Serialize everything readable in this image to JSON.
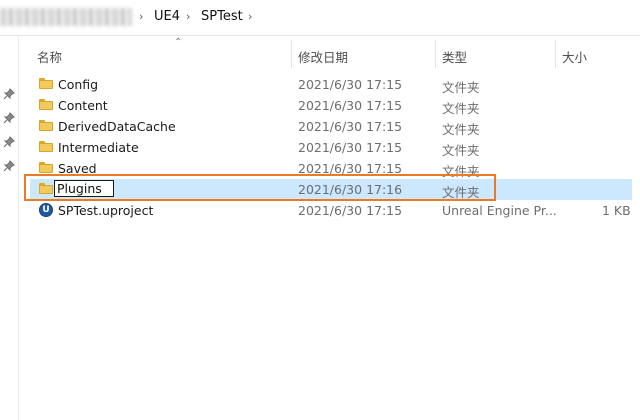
{
  "breadcrumb": {
    "segments": [
      "UE4",
      "SPTest"
    ],
    "separator": "›"
  },
  "columns": {
    "name": "名称",
    "date": "修改日期",
    "type": "类型",
    "size": "大小"
  },
  "files": [
    {
      "name": "Config",
      "date": "2021/6/30 17:15",
      "type": "文件夹",
      "size": "",
      "icon": "folder-icon"
    },
    {
      "name": "Content",
      "date": "2021/6/30 17:15",
      "type": "文件夹",
      "size": "",
      "icon": "folder-icon"
    },
    {
      "name": "DerivedDataCache",
      "date": "2021/6/30 17:15",
      "type": "文件夹",
      "size": "",
      "icon": "folder-icon"
    },
    {
      "name": "Intermediate",
      "date": "2021/6/30 17:15",
      "type": "文件夹",
      "size": "",
      "icon": "folder-icon"
    },
    {
      "name": "Saved",
      "date": "2021/6/30 17:15",
      "type": "文件夹",
      "size": "",
      "icon": "folder-icon"
    },
    {
      "name": "Plugins",
      "date": "2021/6/30 17:16",
      "type": "文件夹",
      "size": "",
      "icon": "folder-icon",
      "selected": true,
      "renaming": true
    },
    {
      "name": "SPTest.uproject",
      "date": "2021/6/30 17:15",
      "type": "Unreal Engine Pr...",
      "size": "1 KB",
      "icon": "unreal-engine-icon",
      "icon_glyph": "U"
    }
  ],
  "colors": {
    "selection": "#cce8ff",
    "highlight_border": "#ea7a24",
    "folder": "#f2c95c"
  }
}
